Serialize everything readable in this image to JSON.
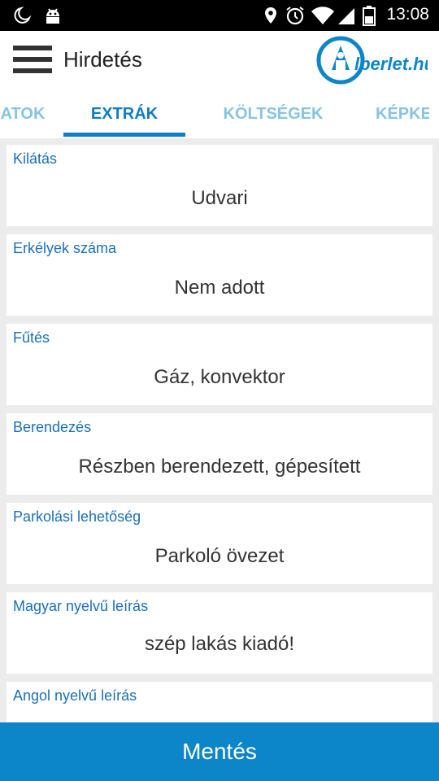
{
  "status_bar": {
    "time": "13:08",
    "icons": [
      "night-mode-icon",
      "android-icon",
      "location-icon",
      "alarm-icon",
      "wifi-icon",
      "signal-icon",
      "battery-icon"
    ]
  },
  "app_bar": {
    "title": "Hirdetés",
    "logo_text": "lberlet.hu"
  },
  "tabs": [
    {
      "label": "ATOK",
      "active": false
    },
    {
      "label": "EXTRÁK",
      "active": true
    },
    {
      "label": "KÖLTSÉGEK",
      "active": false
    },
    {
      "label": "KÉPKE",
      "active": false
    }
  ],
  "fields": [
    {
      "label": "Kilátás",
      "value": "Udvari"
    },
    {
      "label": "Erkélyek száma",
      "value": "Nem adott"
    },
    {
      "label": "Fűtés",
      "value": "Gáz, konvektor"
    },
    {
      "label": "Berendezés",
      "value": "Részben berendezett, gépesített"
    },
    {
      "label": "Parkolási lehetőség",
      "value": "Parkoló övezet"
    },
    {
      "label": "Magyar nyelvű leírás",
      "value": "szép lakás kiadó!"
    },
    {
      "label": "Angol nyelvű leírás",
      "value": ""
    }
  ],
  "save_button": {
    "label": "Mentés"
  },
  "colors": {
    "accent": "#0e7cc6",
    "tab_inactive": "#87c4e4",
    "save_bar": "#0d85c9",
    "label": "#1b6fb8"
  }
}
